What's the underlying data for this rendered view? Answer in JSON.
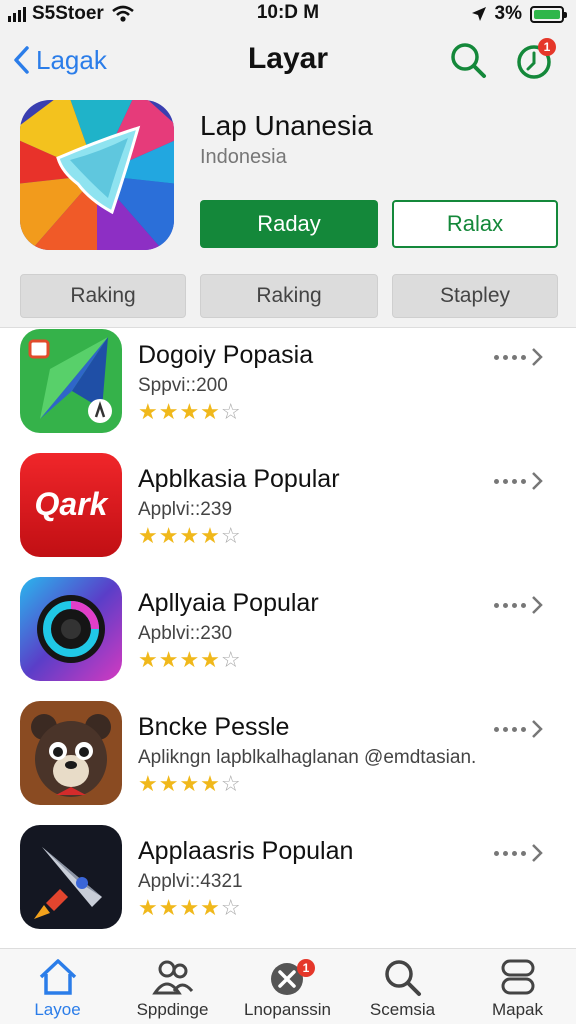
{
  "status_bar": {
    "carrier": "S5Stoer",
    "time": "10:D M",
    "battery": "3%"
  },
  "nav": {
    "back_label": "Lagak",
    "title": "Layar",
    "updates_badge": "1"
  },
  "hero": {
    "name": "Lap Unanesia",
    "subtitle": "Indonesia",
    "primary_button": "Raday",
    "secondary_button": "Ralax"
  },
  "filters": [
    "Raking",
    "Raking",
    "Stapley"
  ],
  "apps": [
    {
      "name": "Dogoiy Popasia",
      "meta": "Sppvi::200",
      "rating": 4,
      "icon": "kite-icon"
    },
    {
      "name": "Apblkasia Popular",
      "meta": "Applvi::239",
      "rating": 4,
      "icon": "qark-logo-icon",
      "logo_text": "Qark"
    },
    {
      "name": "Apllyaia Popular",
      "meta": "Apblvi::230",
      "rating": 4,
      "icon": "swirl-icon"
    },
    {
      "name": "Bncke Pesslе",
      "meta": "Aplikngn lapblkalhaglanan @emdtasian.",
      "rating": 4,
      "icon": "bear-icon"
    },
    {
      "name": "Applaasris Populan",
      "meta": "Applvi::4321",
      "rating": 4,
      "icon": "rocket-icon"
    }
  ],
  "tabs": [
    {
      "label": "Layoe",
      "icon": "home-icon",
      "active": true
    },
    {
      "label": "Sppdinge",
      "icon": "people-icon"
    },
    {
      "label": "Lnopanssin",
      "icon": "close-circle-icon",
      "badge": "1"
    },
    {
      "label": "Scemsia",
      "icon": "search-icon"
    },
    {
      "label": "Mapak",
      "icon": "stack-icon"
    }
  ],
  "colors": {
    "accent_green": "#14883a",
    "link_blue": "#2b7de9",
    "star": "#f0b81b",
    "badge_red": "#e5372a"
  }
}
